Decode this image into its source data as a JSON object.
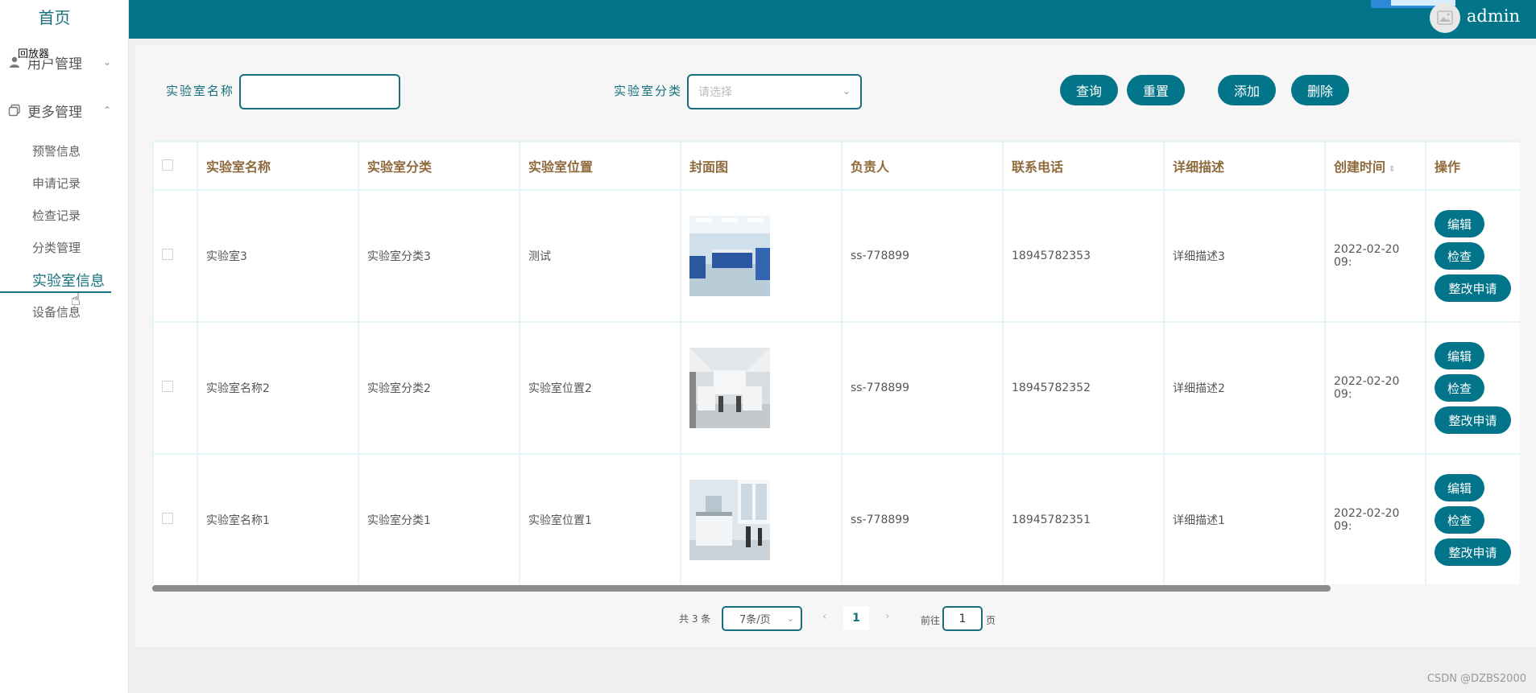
{
  "sidebar": {
    "home": "首页",
    "tooltip": "回放器",
    "groups": [
      {
        "label": "用户管理",
        "chevron": "⌄"
      },
      {
        "label": "更多管理",
        "chevron": "⌃"
      }
    ],
    "sub_items": [
      "预警信息",
      "申请记录",
      "检查记录",
      "分类管理",
      "实验室信息",
      "设备信息"
    ]
  },
  "header": {
    "username": "admin"
  },
  "filters": {
    "name_label": "实验室名称",
    "name_value": "",
    "category_label": "实验室分类",
    "category_placeholder": "请选择"
  },
  "actions": {
    "query": "查询",
    "reset": "重置",
    "add": "添加",
    "delete": "删除"
  },
  "table": {
    "columns": [
      "实验室名称",
      "实验室分类",
      "实验室位置",
      "封面图",
      "负责人",
      "联系电话",
      "详细描述",
      "创建时间",
      "操作"
    ],
    "rows": [
      {
        "name": "实验室3",
        "category": "实验室分类3",
        "location": "测试",
        "owner": "ss-778899",
        "phone": "18945782353",
        "desc": "详细描述3",
        "created": "2022-02-20 09:"
      },
      {
        "name": "实验室名称2",
        "category": "实验室分类2",
        "location": "实验室位置2",
        "owner": "ss-778899",
        "phone": "18945782352",
        "desc": "详细描述2",
        "created": "2022-02-20 09:"
      },
      {
        "name": "实验室名称1",
        "category": "实验室分类1",
        "location": "实验室位置1",
        "owner": "ss-778899",
        "phone": "18945782351",
        "desc": "详细描述1",
        "created": "2022-02-20 09:"
      }
    ],
    "row_actions": {
      "edit": "编辑",
      "check": "检查",
      "rectify": "整改申请"
    }
  },
  "pagination": {
    "total": "共 3 条",
    "page_size": "7条/页",
    "current": "1",
    "goto_label": "前往",
    "goto_value": "1",
    "page_suffix": "页"
  },
  "watermark": "CSDN @DZBS2000",
  "colors": {
    "primary": "#03758a",
    "header_text": "#8f6a3d"
  }
}
